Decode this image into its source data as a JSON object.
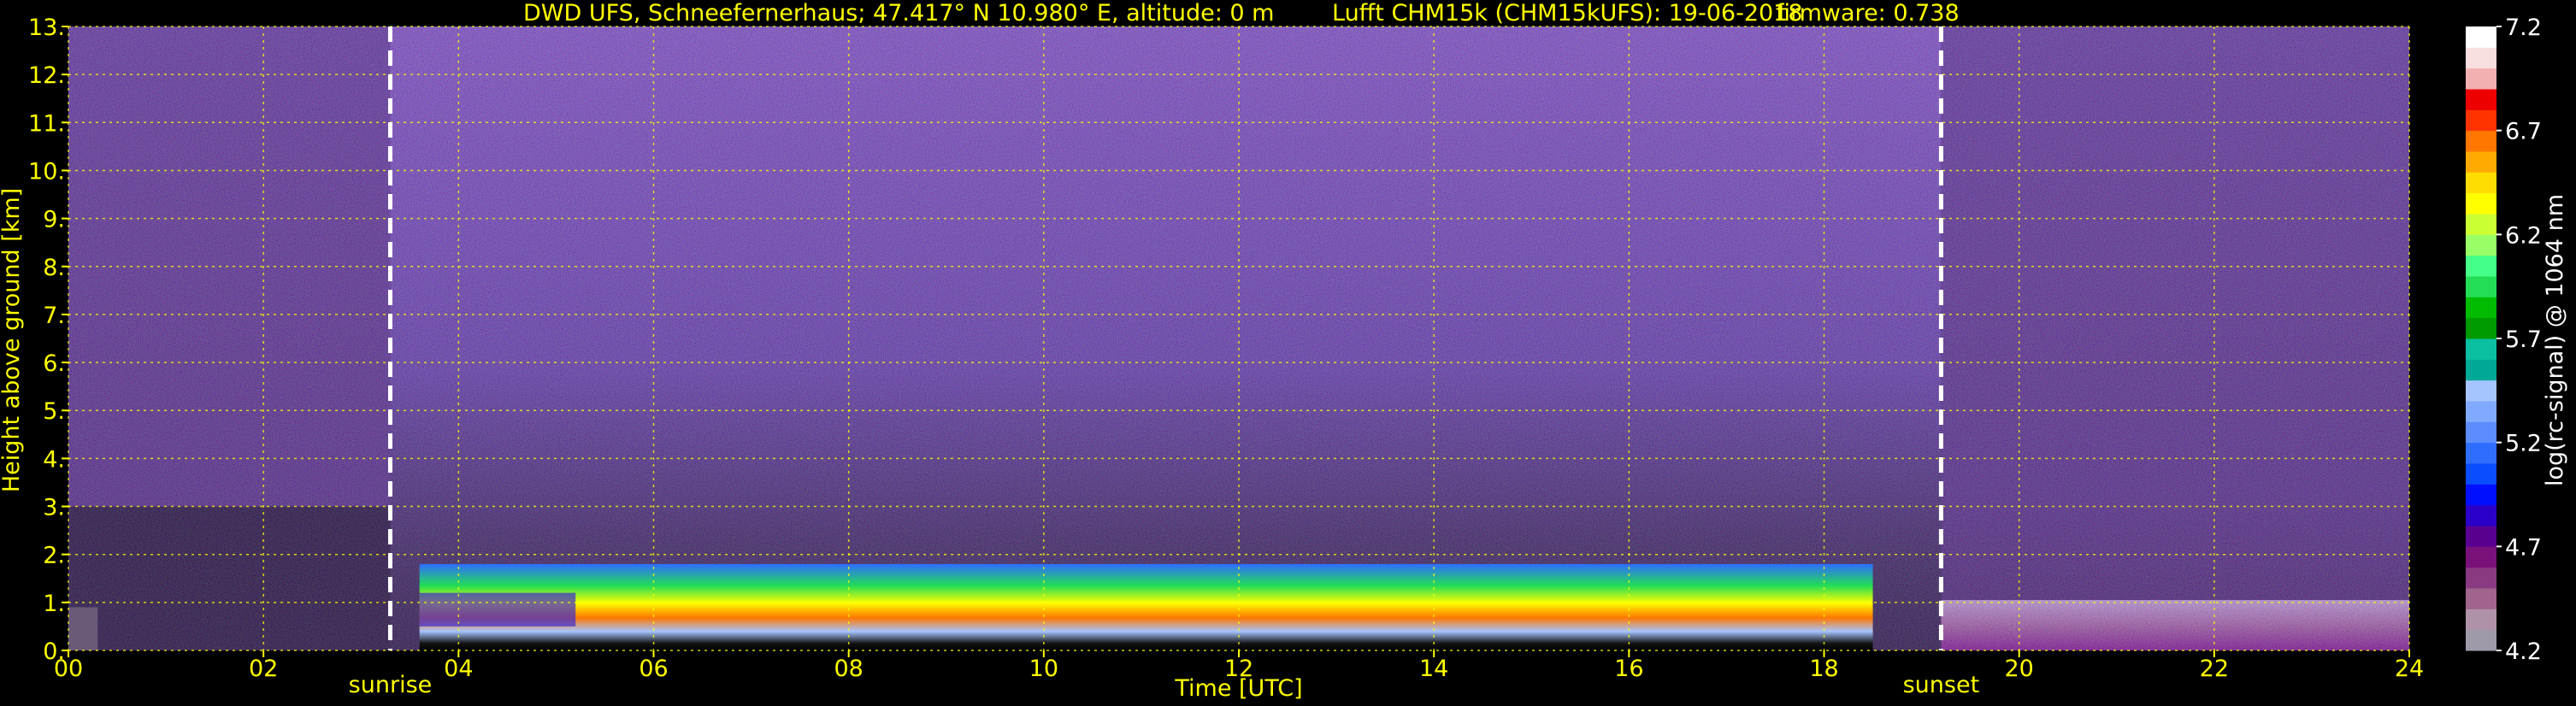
{
  "header": {
    "station": "DWD UFS, Schneefernerhaus; 47.417° N 10.980° E, altitude: 0 m",
    "instrument": "Lufft CHM15k (CHM15kUFS): 19-06-2018",
    "firmware": "firmware: 0.738"
  },
  "chart_data": {
    "type": "heatmap",
    "xlabel": "Time [UTC]",
    "ylabel": "Height above ground [km]",
    "xlim": [
      0,
      24
    ],
    "ylim": [
      0,
      13
    ],
    "x_ticks": [
      "00",
      "02",
      "04",
      "06",
      "08",
      "10",
      "12",
      "14",
      "16",
      "18",
      "20",
      "22",
      "24"
    ],
    "x_tick_values": [
      0,
      2,
      4,
      6,
      8,
      10,
      12,
      14,
      16,
      18,
      20,
      22,
      24
    ],
    "y_ticks": [
      "0.",
      "1.",
      "2.",
      "3.",
      "4.",
      "5.",
      "6.",
      "7.",
      "8.",
      "9.",
      "10.",
      "11.",
      "12.",
      "13."
    ],
    "y_tick_values": [
      0,
      1,
      2,
      3,
      4,
      5,
      6,
      7,
      8,
      9,
      10,
      11,
      12,
      13
    ],
    "grid": true,
    "grid_color": "#ffff00",
    "colorbar": {
      "label": "log(rc-signal) @ 1064 nm",
      "range": [
        4.2,
        7.2
      ],
      "ticks": [
        "7.2",
        "6.7",
        "6.2",
        "5.7",
        "5.2",
        "4.7",
        "4.2"
      ],
      "tick_values": [
        7.2,
        6.7,
        6.2,
        5.7,
        5.2,
        4.7,
        4.2
      ],
      "colors": [
        "#9e9aaa",
        "#b092a8",
        "#a0648e",
        "#8a3a80",
        "#7a107a",
        "#5a0090",
        "#2a00c8",
        "#0010ff",
        "#0a4cff",
        "#2f6dff",
        "#5c8cff",
        "#7faaff",
        "#a6c4ff",
        "#00a896",
        "#0bc0a0",
        "#009900",
        "#00bb00",
        "#22dd55",
        "#44ff88",
        "#99ff66",
        "#ccff33",
        "#ffff00",
        "#ffdd00",
        "#ffaa00",
        "#ff7700",
        "#ff3300",
        "#ee0000",
        "#f2b0b0",
        "#f8dede",
        "#ffffff"
      ]
    },
    "events": [
      {
        "label": "sunrise",
        "x": 3.3
      },
      {
        "label": "sunset",
        "x": 19.2
      }
    ],
    "boundary_layer": [
      {
        "x_start": 3.6,
        "x_end": 18.5,
        "top_km": 1.8
      }
    ]
  }
}
